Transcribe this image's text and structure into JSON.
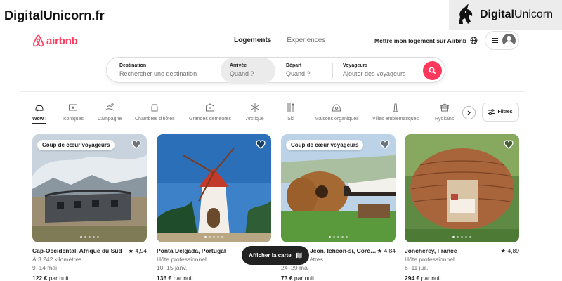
{
  "overlay": {
    "left_brand": "DigitalUnicorn.fr",
    "right_brand_bold": "Digital",
    "right_brand_light": "Unicorn"
  },
  "header": {
    "logo_text": "airbnb",
    "nav": [
      {
        "label": "Logements",
        "active": true
      },
      {
        "label": "Expériences",
        "active": false
      }
    ],
    "host_link": "Mettre mon logement sur Airbnb",
    "icons": [
      "globe-icon",
      "menu-icon",
      "avatar-icon"
    ]
  },
  "search": {
    "destination": {
      "label": "Destination",
      "placeholder": "Rechercher une destination"
    },
    "arrival": {
      "label": "Arrivée",
      "placeholder": "Quand ?"
    },
    "departure": {
      "label": "Départ",
      "placeholder": "Quand ?"
    },
    "travelers": {
      "label": "Voyageurs",
      "placeholder": "Ajouter des voyageurs"
    },
    "button_icon": "search-icon"
  },
  "categories": [
    {
      "label": "Wow !",
      "icon": "wow-icon",
      "active": true
    },
    {
      "label": "Iconiques",
      "icon": "iconic-icon",
      "active": false
    },
    {
      "label": "Campagne",
      "icon": "countryside-icon",
      "active": false
    },
    {
      "label": "Chambres d'hôtes",
      "icon": "bed-breakfast-icon",
      "active": false
    },
    {
      "label": "Grandes demeures",
      "icon": "mansion-icon",
      "active": false
    },
    {
      "label": "Arctique",
      "icon": "snowflake-icon",
      "active": false
    },
    {
      "label": "Ski",
      "icon": "ski-icon",
      "active": false
    },
    {
      "label": "Maisons organiques",
      "icon": "organic-house-icon",
      "active": false
    },
    {
      "label": "Villes emblématiques",
      "icon": "landmark-icon",
      "active": false
    },
    {
      "label": "Ryokans",
      "icon": "ryokan-icon",
      "active": false
    }
  ],
  "filters_label": "Filtres",
  "listings": [
    {
      "badge": "Coup de cœur voyageurs",
      "title": "Cap-Occidental, Afrique du Sud",
      "rating": "4,94",
      "line1": "À 3 242 kilomètres",
      "line2": "9–14 mai",
      "price": "122 €",
      "price_suffix": "par nuit"
    },
    {
      "badge": "",
      "title": "Ponta Delgada, Portugal",
      "rating": "",
      "line1": "Hôte professionnel",
      "line2": "10–15 janv.",
      "price": "136 €",
      "price_suffix": "par nuit"
    },
    {
      "badge": "Coup de cœur voyageurs",
      "title": "Jeon, Icheon-si, Coré…",
      "rating": "4,84",
      "line1": "ètres",
      "line2": "24–29 mai",
      "price": "73 €",
      "price_suffix": "par nuit"
    },
    {
      "badge": "",
      "title": "Joncherey, France",
      "rating": "4,89",
      "line1": "Hôte professionnel",
      "line2": "6–11 juil.",
      "price": "294 €",
      "price_suffix": "par nuit"
    }
  ],
  "map_button": "Afficher la carte",
  "colors": {
    "accent": "#ff385c",
    "text": "#222222",
    "muted": "#717171",
    "border": "#dddddd"
  }
}
